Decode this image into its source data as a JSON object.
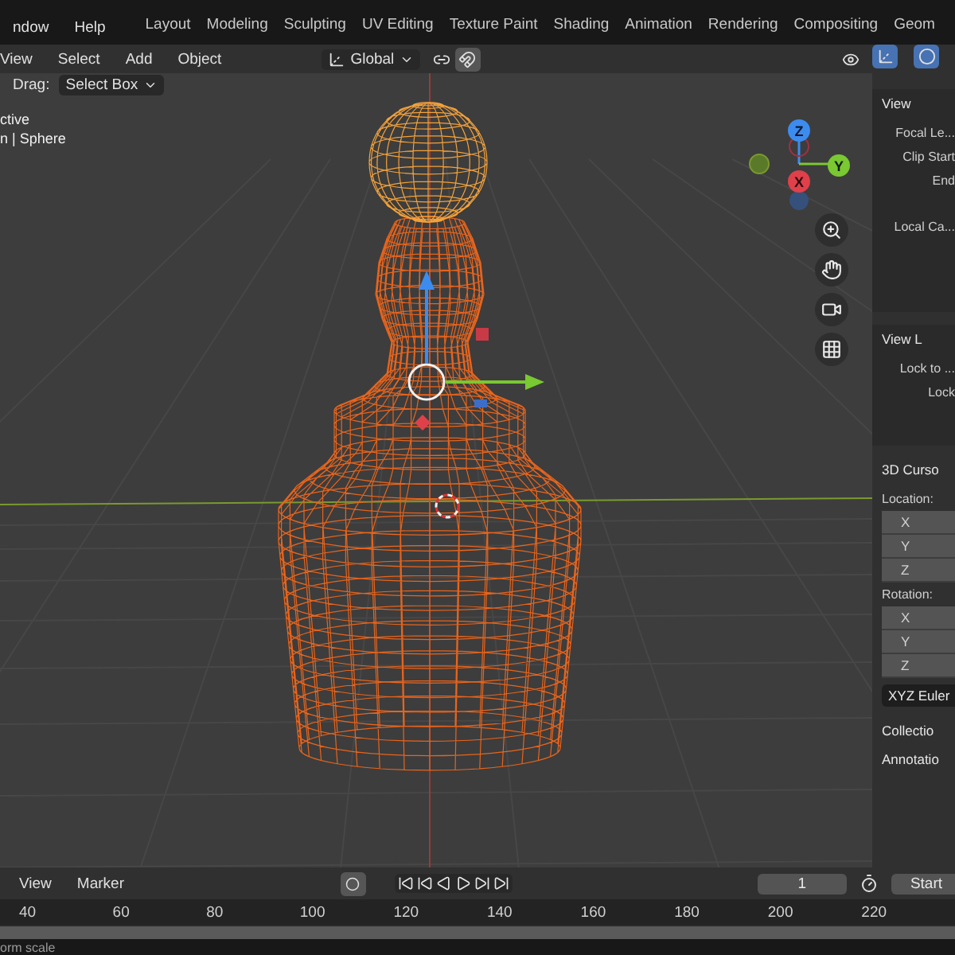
{
  "top_menu": [
    "ndow",
    "Help"
  ],
  "workspace_tabs": [
    {
      "label": "Layout",
      "selected": false
    },
    {
      "label": "Modeling",
      "selected": false
    },
    {
      "label": "Sculpting",
      "selected": false
    },
    {
      "label": "UV Editing",
      "selected": false
    },
    {
      "label": "Texture Paint",
      "selected": false
    },
    {
      "label": "Shading",
      "selected": false
    },
    {
      "label": "Animation",
      "selected": false
    },
    {
      "label": "Rendering",
      "selected": false
    },
    {
      "label": "Compositing",
      "selected": false
    },
    {
      "label": "Geom",
      "selected": false
    }
  ],
  "header_menu": [
    "View",
    "Select",
    "Add",
    "Object"
  ],
  "transform_orientation": "Global",
  "header_toggles": [
    {
      "kind": "proportional",
      "on": true
    },
    {
      "kind": "gizmo",
      "on": true
    },
    {
      "kind": "overlay",
      "on": true
    }
  ],
  "tool_settings": {
    "label": "Drag:",
    "value": "Select Box"
  },
  "viewport": {
    "overlay_lines": [
      "ctive",
      "n | Sphere"
    ],
    "axis_labels": {
      "z": "Z",
      "y": "Y",
      "x": "X"
    }
  },
  "sidebar": {
    "view_section": "View",
    "view_fields": [
      "Focal Le...",
      "Clip Start",
      "End",
      "Local Ca..."
    ],
    "view_lock_section": "View L",
    "lock_fields": [
      "Lock to ...",
      "Lock"
    ],
    "cursor_section": "3D Curso",
    "location_label": "Location:",
    "location_axes": [
      "X",
      "Y",
      "Z"
    ],
    "rotation_label": "Rotation:",
    "rotation_axes": [
      "X",
      "Y",
      "Z"
    ],
    "rotation_mode": "XYZ Euler",
    "collapsed_sections": [
      "Collectio",
      "Annotatio"
    ]
  },
  "timeline": {
    "menu": [
      "View",
      "Marker"
    ],
    "current_frame": "1",
    "start_label": "Start",
    "ruler_ticks": [
      "40",
      "60",
      "80",
      "100",
      "120",
      "140",
      "160",
      "180",
      "200",
      "220"
    ]
  },
  "status_bar": {
    "text": "orm scale"
  }
}
